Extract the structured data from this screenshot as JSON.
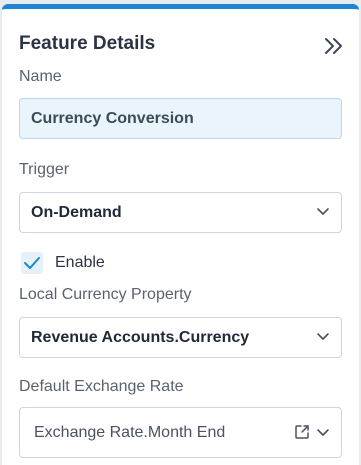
{
  "panel": {
    "title": "Feature Details",
    "collapse_icon": "double-chevron-right-icon"
  },
  "fields": {
    "name": {
      "label": "Name",
      "value": "Currency Conversion"
    },
    "trigger": {
      "label": "Trigger",
      "value": "On-Demand"
    },
    "enable": {
      "label": "Enable",
      "checked": true
    },
    "local_currency_property": {
      "label": "Local Currency Property",
      "value": "Revenue Accounts.Currency"
    },
    "default_exchange_rate": {
      "label": "Default Exchange Rate",
      "value": "Exchange Rate.Month End"
    }
  },
  "colors": {
    "accent": "#1f84d6",
    "check": "#1b87c7"
  }
}
